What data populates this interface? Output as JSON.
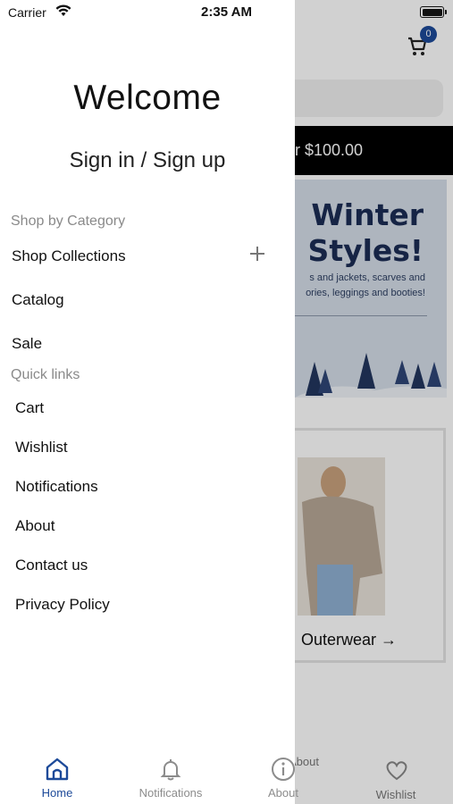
{
  "status_bar": {
    "carrier": "Carrier",
    "time": "2:35 AM"
  },
  "drawer": {
    "welcome": "Welcome",
    "sign_in": "Sign in / Sign up",
    "shop_section": "Shop by Category",
    "shop_items": [
      "Shop Collections",
      "Catalog",
      "Sale"
    ],
    "quick_section": "Quick links",
    "quick_items": [
      "Cart",
      "Wishlist",
      "Notifications",
      "About",
      "Contact us",
      "Privacy Policy"
    ]
  },
  "tabbar": {
    "items": [
      {
        "label": "Home",
        "icon": "home-icon",
        "active": true
      },
      {
        "label": "Notifications",
        "icon": "bell-icon",
        "active": false
      },
      {
        "label": "About",
        "icon": "info-icon",
        "active": false
      },
      {
        "label": "Wishlist",
        "icon": "heart-icon",
        "active": false
      }
    ],
    "active_color": "#1d4a99",
    "inactive_color": "#8c8c8c"
  },
  "background": {
    "cart_count": "0",
    "banner_text": "r $100.00",
    "promo_title_line1": "Winter",
    "promo_title_line2": "Styles!",
    "promo_text_line1": "s and jackets, scarves and",
    "promo_text_line2": "ories, leggings and booties!",
    "card_label": "Outerwear →",
    "tab_wishlist": "Wishlist",
    "tab_about": "About"
  }
}
